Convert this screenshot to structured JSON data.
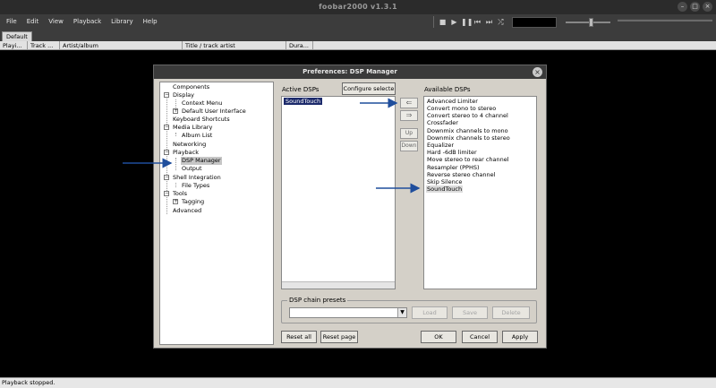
{
  "window": {
    "title": "foobar2000 v1.3.1"
  },
  "menu": [
    {
      "label": "File"
    },
    {
      "label": "Edit"
    },
    {
      "label": "View"
    },
    {
      "label": "Playback"
    },
    {
      "label": "Library"
    },
    {
      "label": "Help"
    }
  ],
  "transport_icons": [
    "stop-icon",
    "play-icon",
    "pause-icon",
    "previous-icon",
    "next-icon",
    "random-icon"
  ],
  "playlist": {
    "tab": "Default",
    "columns": [
      "Playi...",
      "Track ...",
      "Artist/album",
      "Title / track artist",
      "Dura..."
    ]
  },
  "status": "Playback stopped.",
  "dialog": {
    "title": "Preferences: DSP Manager",
    "tree": [
      {
        "label": "Components",
        "level": 0
      },
      {
        "label": "Display",
        "level": 0,
        "expander": "−"
      },
      {
        "label": "Context Menu",
        "level": 1
      },
      {
        "label": "Default User Interface",
        "level": 1,
        "expander": "+"
      },
      {
        "label": "Keyboard Shortcuts",
        "level": 0
      },
      {
        "label": "Media Library",
        "level": 0,
        "expander": "−"
      },
      {
        "label": "Album List",
        "level": 1
      },
      {
        "label": "Networking",
        "level": 0
      },
      {
        "label": "Playback",
        "level": 0,
        "expander": "−"
      },
      {
        "label": "DSP Manager",
        "level": 1,
        "selected": true
      },
      {
        "label": "Output",
        "level": 1
      },
      {
        "label": "Shell Integration",
        "level": 0,
        "expander": "−"
      },
      {
        "label": "File Types",
        "level": 1
      },
      {
        "label": "Tools",
        "level": 0,
        "expander": "−"
      },
      {
        "label": "Tagging",
        "level": 1,
        "expander": "+"
      },
      {
        "label": "Advanced",
        "level": 0
      }
    ],
    "active_dsps": {
      "label": "Active DSPs",
      "items": [
        "SoundTouch"
      ],
      "configure_button": "Configure selecte"
    },
    "move_buttons": {
      "up": "Up",
      "down": "Down"
    },
    "available_dsps": {
      "label": "Available DSPs",
      "items": [
        "Advanced Limiter",
        "Convert mono to stereo",
        "Convert stereo to 4 channel",
        "Crossfader",
        "Downmix channels to mono",
        "Downmix channels to stereo",
        "Equalizer",
        "Hard -6dB limiter",
        "Move stereo to rear channel",
        "Resampler (PPHS)",
        "Reverse stereo channel",
        "Skip Silence",
        "SoundTouch"
      ]
    },
    "presets": {
      "label": "DSP chain presets",
      "load": "Load",
      "save": "Save",
      "delete": "Delete"
    },
    "buttons": {
      "reset_all": "Reset all",
      "reset_page": "Reset page",
      "ok": "OK",
      "cancel": "Cancel",
      "apply": "Apply"
    }
  },
  "colors": {
    "titlebar": "#2b2b2b",
    "selection": "#1c2a6b",
    "annotation_arrow": "#1f4e9c"
  }
}
